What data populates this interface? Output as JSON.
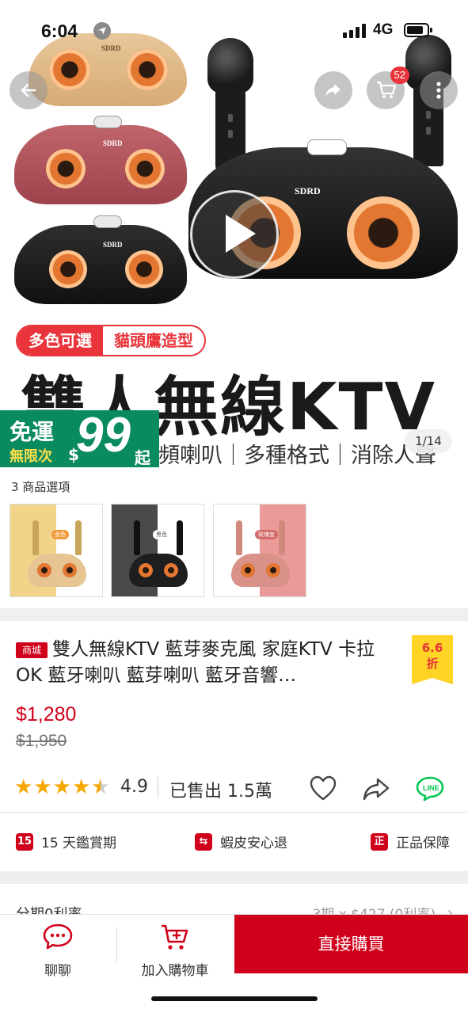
{
  "status_bar": {
    "time": "6:04",
    "network": "4G"
  },
  "hero": {
    "cart_count": "52",
    "brand_text": "SDRD",
    "tag_left": "多色可選",
    "tag_right": "貓頭鷹造型",
    "big_title": "雙人無線KTV",
    "sub_line": "頻喇叭｜多種格式｜消除人聲",
    "counter": "1/14",
    "free_shipping": {
      "top": "免運",
      "bottom": "無限次",
      "dollar": "$",
      "amount": "99",
      "suffix": "起"
    }
  },
  "variations": {
    "label": "3 商品選項",
    "options": [
      {
        "tag": "金色",
        "color": "#f2d38a"
      },
      {
        "tag": "黑色",
        "color": "#4a4a4a"
      },
      {
        "tag": "玫瑰金",
        "color": "#ea9a98"
      }
    ]
  },
  "product": {
    "mall_tag": "商城",
    "name": "雙人無線KTV 藍芽麥克風 家庭KTV 卡拉OK 藍牙喇叭 藍芽喇叭 藍牙音響…",
    "discount_value": "6.6",
    "discount_unit": "折",
    "price": "$1,280",
    "original_price": "$1,950",
    "rating": "4.9",
    "stars": 4.5,
    "sold": "已售出 1.5萬"
  },
  "guarantees": [
    {
      "label": "15 天鑑賞期"
    },
    {
      "label": "蝦皮安心退"
    },
    {
      "label": "正品保障"
    }
  ],
  "installment": {
    "label": "分期0利率",
    "detail": "3期 x $427 (0利率)"
  },
  "bottom_bar": {
    "chat": "聊聊",
    "add_to_cart": "加入購物車",
    "buy_now": "直接購買"
  },
  "colors": {
    "brand_red": "#d0011b",
    "accent_red": "#e8343a",
    "free_ship_green": "#0a8a5f",
    "star": "#f6a700",
    "line_green": "#06c755"
  }
}
